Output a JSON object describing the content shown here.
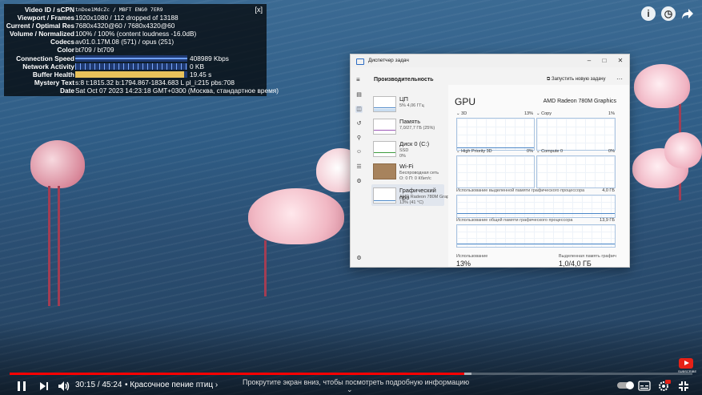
{
  "stats": {
    "close": "[x]",
    "rows": [
      {
        "k": "Video ID / sCPN",
        "v": "tnDoe1MdcZc / MBFT ENG0 7ER9"
      },
      {
        "k": "Viewport / Frames",
        "v": "1920x1080 / 112 dropped of 13188"
      },
      {
        "k": "Current / Optimal Res",
        "v": "7680x4320@60 / 7680x4320@60"
      },
      {
        "k": "Volume / Normalized",
        "v": "100% / 100% (content loudness -16.0dB)"
      },
      {
        "k": "Codecs",
        "v": "av01.0.17M.08 (571) / opus (251)"
      },
      {
        "k": "Color",
        "v": "bt709 / bt709"
      },
      {
        "k": "Connection Speed",
        "v": "408989 Kbps"
      },
      {
        "k": "Network Activity",
        "v": "0 KB"
      },
      {
        "k": "Buffer Health",
        "v": "19.45 s"
      },
      {
        "k": "Mystery Text",
        "v": "s:8 t:1815.32 b:1794.867-1834.683 L pl_i:215 pbs:708"
      },
      {
        "k": "Date",
        "v": "Sat Oct 07 2023 14:23:18 GMT+0300 (Москва, стандартное время)"
      }
    ],
    "buffer_health_fraction": 0.97
  },
  "top_right": {
    "info_icon": "info-icon",
    "clock_icon": "clock-icon",
    "share_icon": "share-icon"
  },
  "task_manager": {
    "title": "Диспетчер задач",
    "window_buttons": {
      "minimize": "–",
      "maximize": "□",
      "close": "✕"
    },
    "section": "Производительность",
    "run_task": "Запустить новую задачу",
    "more": "···",
    "items": [
      {
        "title": "ЦП",
        "sub1": "5% 4,06 ГГц",
        "sub2": ""
      },
      {
        "title": "Память",
        "sub1": "7,0/27,7 ГБ (25%)",
        "sub2": ""
      },
      {
        "title": "Диск 0 (C:)",
        "sub1": "SSD",
        "sub2": "0%"
      },
      {
        "title": "Wi-Fi",
        "sub1": "Беспроводная сеть",
        "sub2": "О: 0 П: 0 Кбит/с"
      },
      {
        "title": "Графический про",
        "sub1": "AMD Radeon 780M Grap",
        "sub2": "13% (41 °C)"
      }
    ],
    "gpu": {
      "title": "GPU",
      "name": "AMD Radeon 780M Graphics",
      "engines": [
        {
          "label": "3D",
          "pct": "13%"
        },
        {
          "label": "Copy",
          "pct": "1%"
        },
        {
          "label": "High Priority 3D",
          "pct": "0%"
        },
        {
          "label": "Compute 0",
          "pct": "0%"
        }
      ],
      "dedicated_label": "Использование выделенной памяти графического процессора",
      "dedicated_max": "4,0 ГБ",
      "shared_label": "Использование общей памяти графического процессора",
      "shared_max": "13,9 ГБ",
      "util_label": "Использование",
      "util_value": "13%",
      "dedicated_mem_label": "Выделенная память графич",
      "dedicated_mem_value": "1,0/4,0 ГБ"
    }
  },
  "player": {
    "time": "30:15 / 45:24",
    "chapter": "• Красочное пение птиц ›",
    "scroll_hint": "Прокрутите экран вниз, чтобы посмотреть подробную информацию",
    "chevron": "⌄",
    "progress_played_fraction": 0.666,
    "progress_buffered_fraction": 0.677
  }
}
